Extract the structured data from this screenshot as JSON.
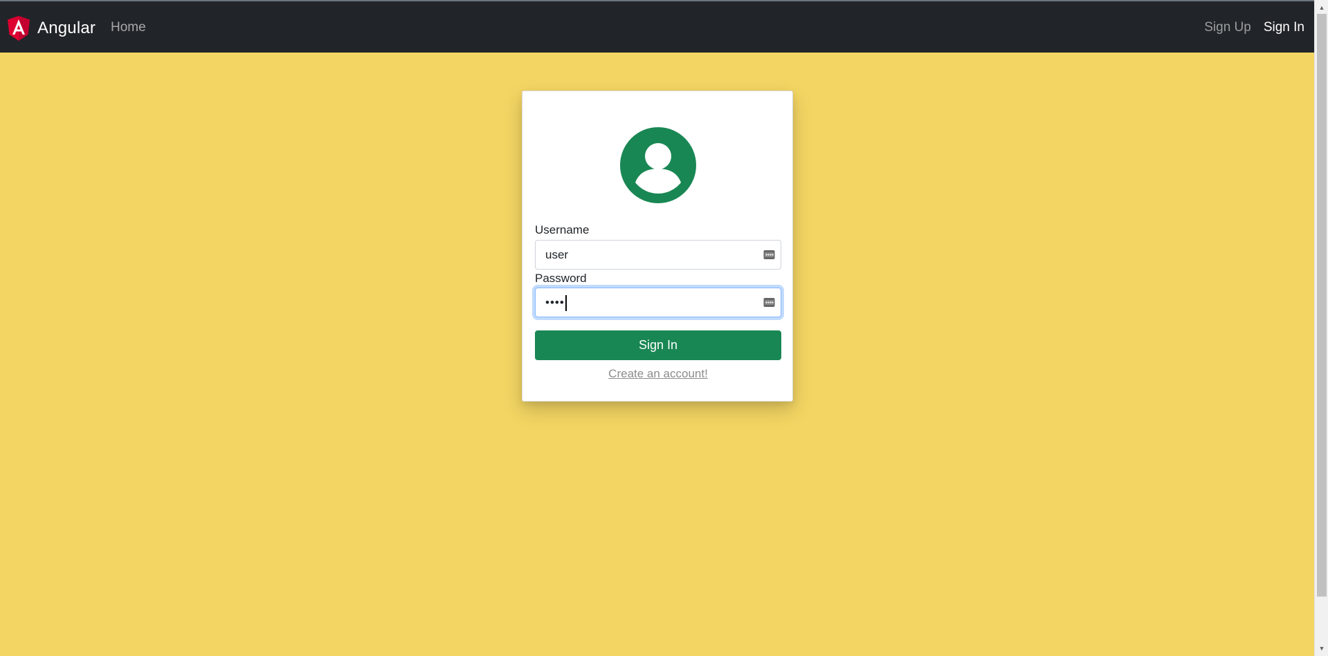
{
  "navbar": {
    "brand_text": "Angular",
    "home_label": "Home",
    "signup_label": "Sign Up",
    "signin_label": "Sign In"
  },
  "login": {
    "username_label": "Username",
    "username_value": "user",
    "password_label": "Password",
    "password_value": "••••",
    "submit_label": "Sign In",
    "create_account_label": "Create an account!"
  },
  "icons": {
    "brand": "angular-logo-icon",
    "avatar": "user-avatar-icon",
    "autofill": "password-manager-icon"
  },
  "colors": {
    "navbar_bg": "#212529",
    "page_bg": "#f3d563",
    "primary_green": "#198754",
    "angular_red": "#dd0031"
  }
}
